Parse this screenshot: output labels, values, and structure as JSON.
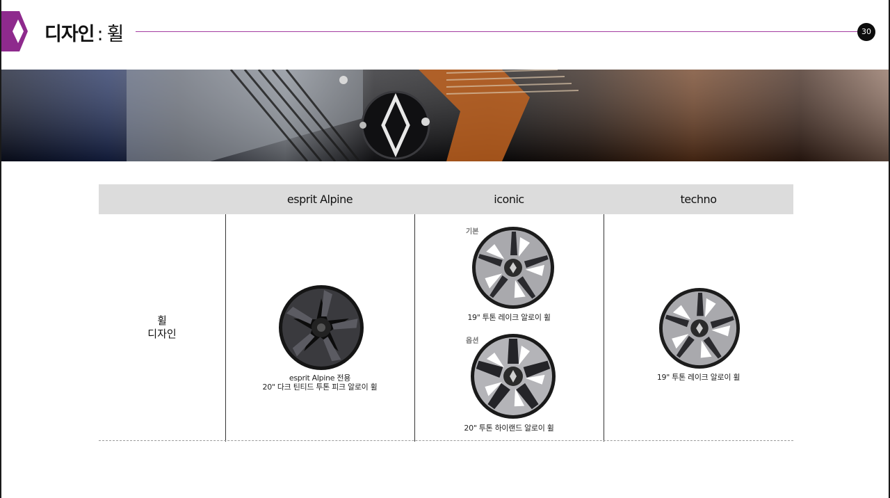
{
  "header": {
    "title_main": "디자인",
    "title_separator": ":",
    "title_sub": "휠",
    "page_number": "30",
    "accent_color": "#8e2a8d"
  },
  "table": {
    "columns": [
      "esprit Alpine",
      "iconic",
      "techno"
    ],
    "row_label_lines": [
      "휠",
      "디자인"
    ],
    "cells": {
      "esprit_alpine": {
        "caption_lines": [
          "esprit Alpine 전용",
          "20\" 다크 틴티드 투톤 피크 알로이 휠"
        ]
      },
      "iconic": {
        "standard_tag": "기본",
        "standard_caption": "19\" 투톤 레이크 알로이 휠",
        "option_tag": "옵션",
        "option_caption": "20\" 투톤 하이랜드 알로이 휠"
      },
      "techno": {
        "caption": "19\" 투톤 레이크 알로이 휠"
      }
    }
  }
}
